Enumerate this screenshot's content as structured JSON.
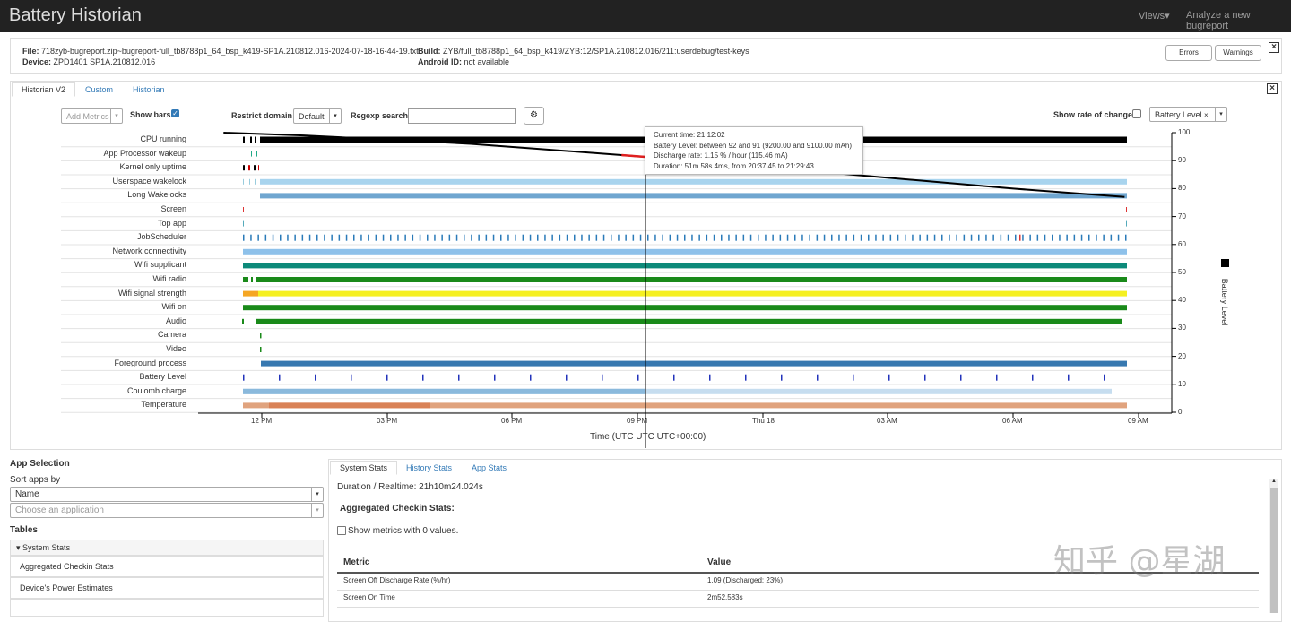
{
  "navbar": {
    "title": "Battery Historian",
    "views": "Views",
    "analyze": "Analyze a new bugreport"
  },
  "fileinfo": {
    "file_label": "File:",
    "file": "718zyb-bugreport.zip~bugreport-full_tb8788p1_64_bsp_k419-SP1A.210812.016-2024-07-18-16-44-19.txt",
    "device_label": "Device:",
    "device": "ZPD1401 SP1A.210812.016",
    "build_label": "Build:",
    "build": "ZYB/full_tb8788p1_64_bsp_k419/ZYB:12/SP1A.210812.016/211:userdebug/test-keys",
    "android_label": "Android ID:",
    "android": "not available",
    "errors": "Errors",
    "warnings": "Warnings"
  },
  "tabs": [
    "Historian V2",
    "Custom",
    "Historian"
  ],
  "controls": {
    "add_metrics": "Add Metrics",
    "show_bars": "Show bars",
    "restrict_domain": "Restrict domain",
    "domain_value": "Default",
    "regexp": "Regexp search",
    "show_rate": "Show rate of change",
    "battery_select": "Battery Level"
  },
  "metrics": [
    "CPU running",
    "App Processor wakeup",
    "Kernel only uptime",
    "Userspace wakelock",
    "Long Wakelocks",
    "Screen",
    "Top app",
    "JobScheduler",
    "Network connectivity",
    "Wifi supplicant",
    "Wifi radio",
    "Wifi signal strength",
    "Wifi on",
    "Audio",
    "Camera",
    "Video",
    "Foreground process",
    "Battery Level",
    "Coulomb charge",
    "Temperature"
  ],
  "axis": {
    "x_ticks": [
      "12 PM",
      "03 PM",
      "06 PM",
      "09 PM",
      "Thu 18",
      "03 AM",
      "06 AM",
      "09 AM"
    ],
    "y_ticks": [
      "100",
      "90",
      "80",
      "70",
      "60",
      "50",
      "40",
      "30",
      "20",
      "10",
      "0"
    ],
    "x_label": "Time (UTC UTC UTC+00:00)",
    "y_label": "Battery Level"
  },
  "chart_data": {
    "type": "line",
    "title": "",
    "xlabel": "Time (UTC UTC UTC+00:00)",
    "ylabel": "Battery Level",
    "ylim": [
      0,
      100
    ],
    "series": [
      {
        "name": "Battery Level",
        "x": [
          "11:05",
          "13:00",
          "17:00",
          "20:37",
          "21:30",
          "06:00",
          "08:40"
        ],
        "values": [
          100,
          99,
          96,
          92,
          91,
          80,
          77
        ]
      }
    ]
  },
  "tooltip": {
    "line1": "Current time: 21:12:02",
    "line2": "Battery Level: between 92 and 91 (9200.00 and 9100.00 mAh)",
    "line3": "Discharge rate: 1.15 % / hour (115.46 mA)",
    "line4": "Duration: 51m 58s 4ms, from 20:37:45 to 21:29:43"
  },
  "app_selection": {
    "title": "App Selection",
    "sort_label": "Sort apps by",
    "sort_value": "Name",
    "choose_placeholder": "Choose an application",
    "tables": "Tables",
    "system_stats": "System Stats",
    "rows": [
      "Aggregated Checkin Stats",
      "Device's Power Estimates"
    ]
  },
  "stats": {
    "tabs": [
      "System Stats",
      "History Stats",
      "App Stats"
    ],
    "duration": "Duration / Realtime: 21h10m24.024s",
    "aggregated": "Aggregated Checkin Stats:",
    "show_zero": "Show metrics with 0 values.",
    "col_metric": "Metric",
    "col_value": "Value",
    "rows": [
      {
        "metric": "Screen Off Discharge Rate (%/hr)",
        "value": "1.09 (Discharged: 23%)"
      },
      {
        "metric": "Screen On Time",
        "value": "2m52.583s"
      }
    ]
  },
  "watermark": "知乎 @星湖"
}
